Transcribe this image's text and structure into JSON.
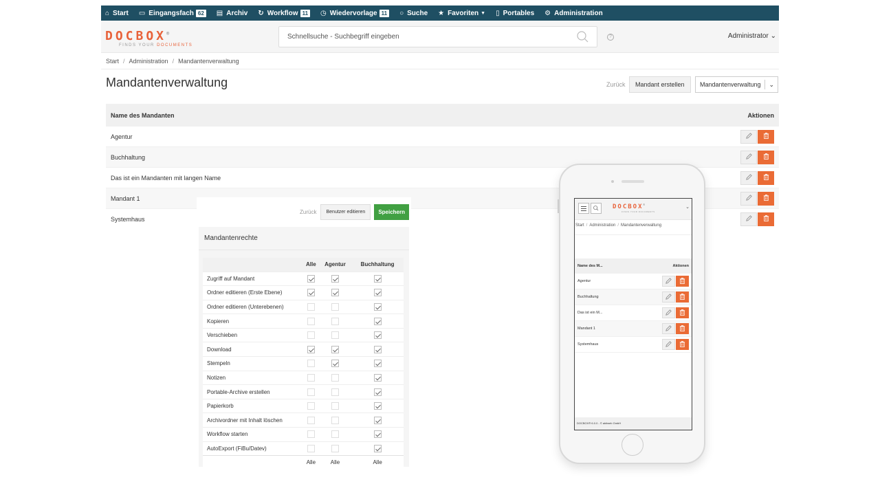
{
  "nav": {
    "items": [
      {
        "label": "Start",
        "icon": "home-icon"
      },
      {
        "label": "Eingangsfach",
        "icon": "inbox-icon",
        "badge": "62"
      },
      {
        "label": "Archiv",
        "icon": "archive-icon"
      },
      {
        "label": "Workflow",
        "icon": "workflow-icon",
        "badge": "11"
      },
      {
        "label": "Wiedervorlage",
        "icon": "clock-icon",
        "badge": "11"
      },
      {
        "label": "Suche",
        "icon": "search-icon"
      },
      {
        "label": "Favoriten",
        "icon": "star-icon"
      },
      {
        "label": "Portables",
        "icon": "portable-icon"
      },
      {
        "label": "Administration",
        "icon": "gear-icon"
      }
    ]
  },
  "header": {
    "logo_text": "DOCBOX",
    "logo_mark": "®",
    "logo_tagline_1": "FINDS YOUR",
    "logo_tagline_2": "DOCUMENTS",
    "search_placeholder": "Schnellsuche - Suchbegriff eingeben",
    "help": "?",
    "user": "Administrator"
  },
  "breadcrumb": [
    "Start",
    "Administration",
    "Mandantenverwaltung"
  ],
  "page": {
    "title": "Mandantenverwaltung",
    "back": "Zurück",
    "create": "Mandant erstellen",
    "view_select": "Mandantenverwaltung"
  },
  "table": {
    "col_name": "Name des Mandanten",
    "col_actions": "Aktionen",
    "rows": [
      "Agentur",
      "Buchhaltung",
      "Das ist ein Mandanten mit langen Name",
      "Mandant 1",
      "Systemhaus"
    ]
  },
  "rights": {
    "back": "Zurück",
    "edit_users": "Benutzer editieren",
    "save": "Speichern",
    "title": "Mandantenrechte",
    "cols": [
      "Alle",
      "Agentur",
      "Buchhaltung"
    ],
    "footer": [
      "Alle",
      "Alle",
      "Alle"
    ],
    "rows": [
      {
        "label": "Zugriff auf Mandant",
        "checked": [
          true,
          true,
          true
        ]
      },
      {
        "label": "Ordner editieren (Erste Ebene)",
        "checked": [
          true,
          true,
          true
        ]
      },
      {
        "label": "Ordner editieren (Unterebenen)",
        "checked": [
          false,
          false,
          true
        ]
      },
      {
        "label": "Kopieren",
        "checked": [
          false,
          false,
          true
        ]
      },
      {
        "label": "Verschieben",
        "checked": [
          false,
          false,
          true
        ]
      },
      {
        "label": "Download",
        "checked": [
          true,
          true,
          true
        ]
      },
      {
        "label": "Stempeln",
        "checked": [
          false,
          true,
          true
        ]
      },
      {
        "label": "Notizen",
        "checked": [
          false,
          false,
          true
        ]
      },
      {
        "label": "Portable-Archive erstellen",
        "checked": [
          false,
          false,
          true
        ]
      },
      {
        "label": "Papierkorb",
        "checked": [
          false,
          false,
          true
        ]
      },
      {
        "label": "Archivordner mit Inhalt löschen",
        "checked": [
          false,
          false,
          true
        ]
      },
      {
        "label": "Workflow starten",
        "checked": [
          false,
          false,
          true
        ]
      },
      {
        "label": "AutoExport (FiBu/Datev)",
        "checked": [
          false,
          false,
          true
        ]
      }
    ]
  },
  "mobile": {
    "logo_text": "DOCBOX",
    "logo_mark": "®",
    "logo_tagline": "FINDS YOUR DOCUMENTS",
    "breadcrumb": [
      "Start",
      "Administration",
      "Mandantenverwaltung"
    ],
    "col_name": "Name des M...",
    "col_actions": "Aktionen",
    "rows": [
      "Agentur",
      "Buchhaltung",
      "Das ist ein M...",
      "Mandant 1",
      "Systemhaus"
    ],
    "footer": "DOCBOX® 6.0.0 - © aktiweb GmbH"
  },
  "colors": {
    "nav_bg": "#1f4f63",
    "brand": "#e8623a",
    "delete": "#ea6b35",
    "save": "#41a042"
  }
}
